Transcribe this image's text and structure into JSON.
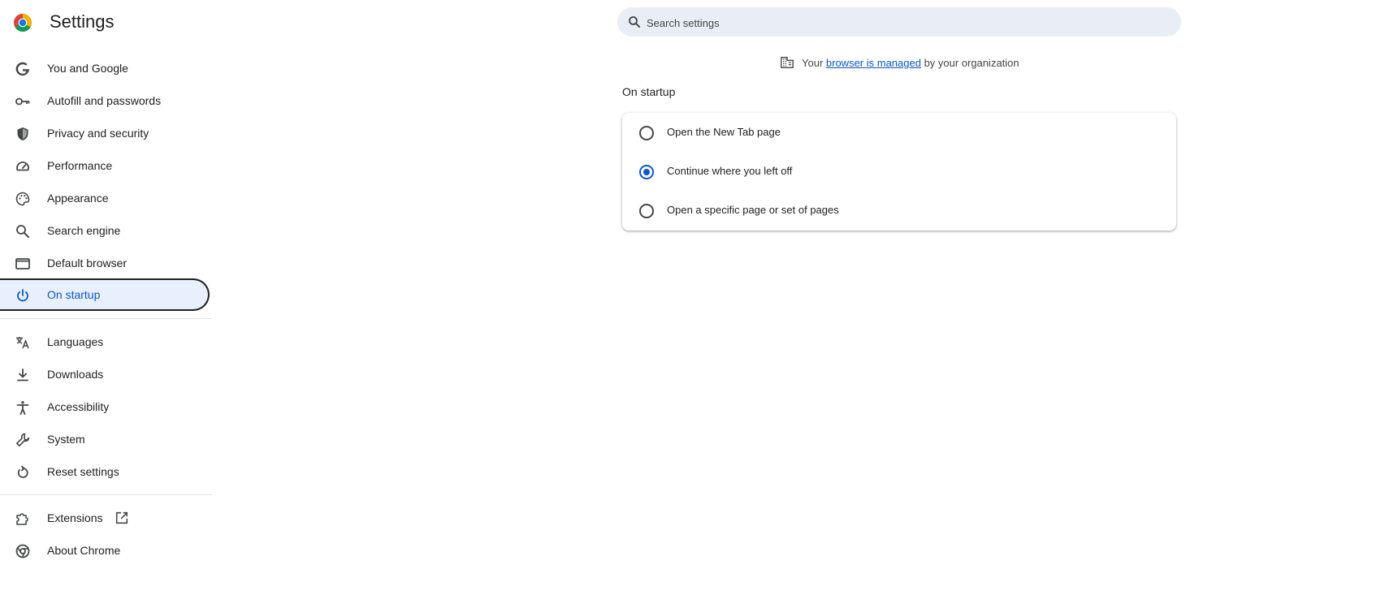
{
  "header": {
    "title": "Settings",
    "logo_icon": "chrome-logo-icon",
    "search": {
      "placeholder": "Search settings",
      "value": "",
      "icon": "search-icon"
    }
  },
  "sidebar": {
    "items": [
      {
        "label": "You and Google",
        "icon": "google-g-icon"
      },
      {
        "label": "Autofill and passwords",
        "icon": "key-icon"
      },
      {
        "label": "Privacy and security",
        "icon": "shield-icon"
      },
      {
        "label": "Performance",
        "icon": "speedometer-icon"
      },
      {
        "label": "Appearance",
        "icon": "palette-icon"
      },
      {
        "label": "Search engine",
        "icon": "search-icon"
      },
      {
        "label": "Default browser",
        "icon": "browser-window-icon"
      },
      {
        "label": "On startup",
        "icon": "power-icon",
        "active": true
      },
      {
        "label": "Languages",
        "icon": "translate-icon"
      },
      {
        "label": "Downloads",
        "icon": "download-icon"
      },
      {
        "label": "Accessibility",
        "icon": "accessibility-icon"
      },
      {
        "label": "System",
        "icon": "wrench-icon"
      },
      {
        "label": "Reset settings",
        "icon": "reset-icon"
      },
      {
        "label": "Extensions",
        "icon": "puzzle-icon"
      },
      {
        "label": "About Chrome",
        "icon": "chrome-outline-icon"
      }
    ]
  },
  "managed_notice": {
    "prefix": "Your ",
    "link": "browser is managed",
    "suffix": " by your organization",
    "icon": "building-icon"
  },
  "main": {
    "section_title": "On startup",
    "options": [
      {
        "label": "Open the New Tab page",
        "checked": false
      },
      {
        "label": "Continue where you left off",
        "checked": true
      },
      {
        "label": "Open a specific page or set of pages",
        "checked": false
      }
    ]
  },
  "colors": {
    "accent": "#0b57d0",
    "active_bg": "#e8f0fe",
    "search_bg": "#e9eef6"
  }
}
